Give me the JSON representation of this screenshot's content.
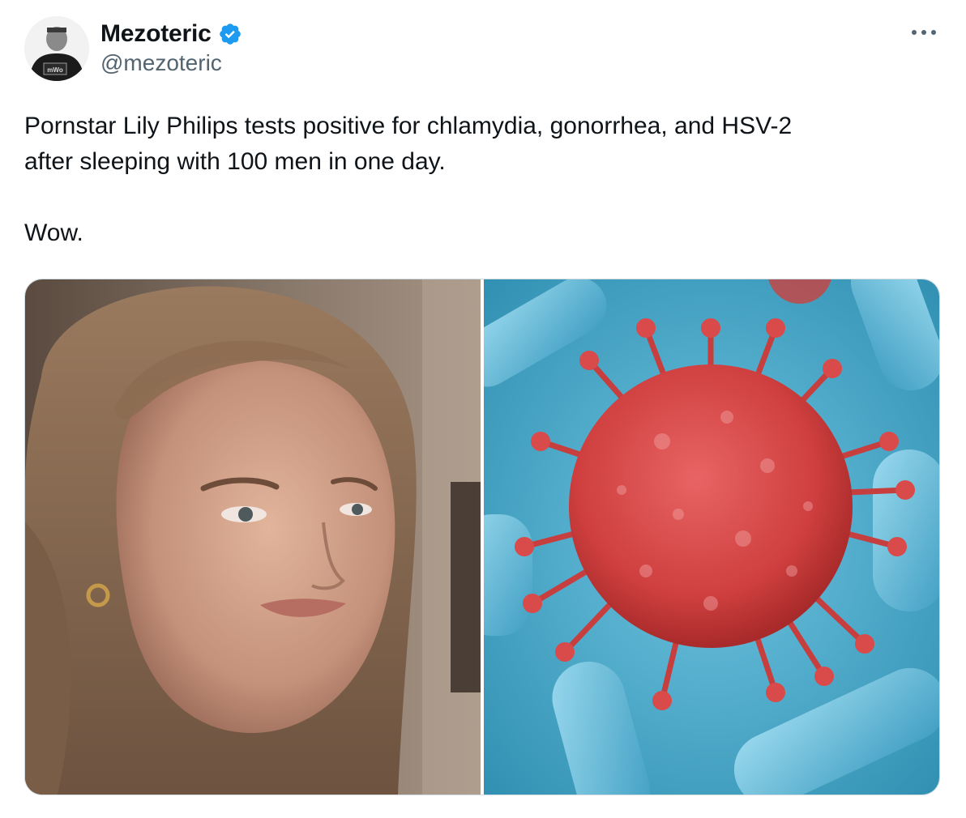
{
  "author": {
    "display_name": "Mezoteric",
    "handle": "@mezoteric",
    "verified": true,
    "avatar_text": "mWo"
  },
  "post": {
    "text": "Pornstar Lily Philips tests positive for chlamydia, gonorrhea, and HSV-2\nafter sleeping with 100 men in one day.\n\nWow."
  },
  "media": [
    {
      "name": "woman-photo"
    },
    {
      "name": "virus-illustration"
    }
  ],
  "colors": {
    "text": "#0f1419",
    "secondary_text": "#536471",
    "verified_badge": "#1d9bf0",
    "media_border": "#cfd9de",
    "virus_red": "#d84a4a",
    "bacteria_blue": "#5fb8d6"
  },
  "icons": {
    "verified": "verified-badge-icon",
    "more": "more-horizontal-icon"
  }
}
